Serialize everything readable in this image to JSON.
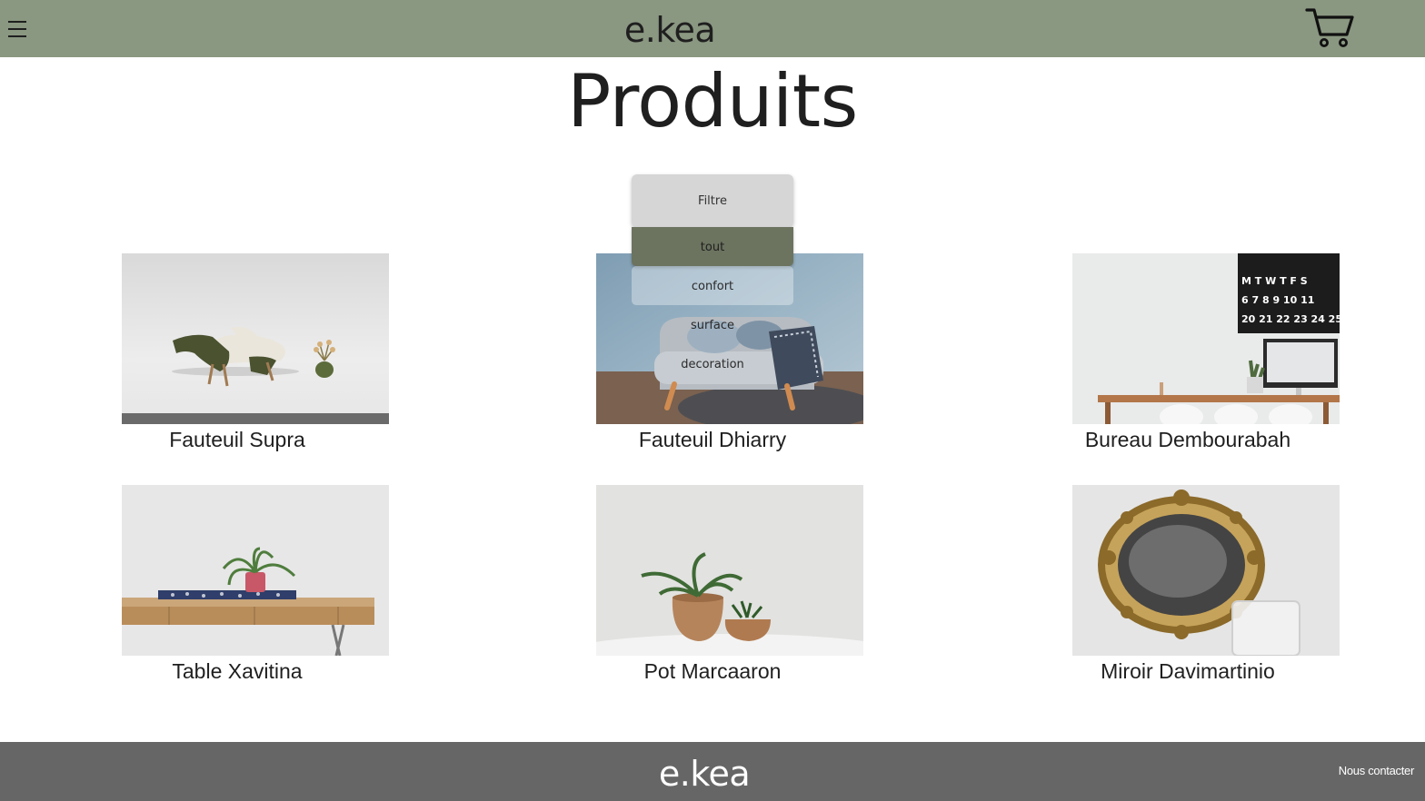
{
  "header": {
    "brand": "e.kea",
    "menu_icon": "hamburger-icon",
    "cart_icon": "cart-icon",
    "background": "#8a9781"
  },
  "main": {
    "title": "Produits",
    "filter": {
      "label": "Filtre",
      "options": [
        "tout",
        "confort",
        "surface",
        "decoration"
      ],
      "selected": "tout",
      "selected_color": "#6c735f"
    },
    "products": [
      {
        "name": "Fauteuil Supra"
      },
      {
        "name": "Fauteuil Dhiarry"
      },
      {
        "name": "Bureau Dembourabah"
      },
      {
        "name": "Table Xavitina"
      },
      {
        "name": "Pot Marcaaron"
      },
      {
        "name": "Miroir Davimartinio"
      }
    ]
  },
  "footer": {
    "brand": "e.kea",
    "contact_label": "Nous contacter",
    "background": "#666666"
  }
}
